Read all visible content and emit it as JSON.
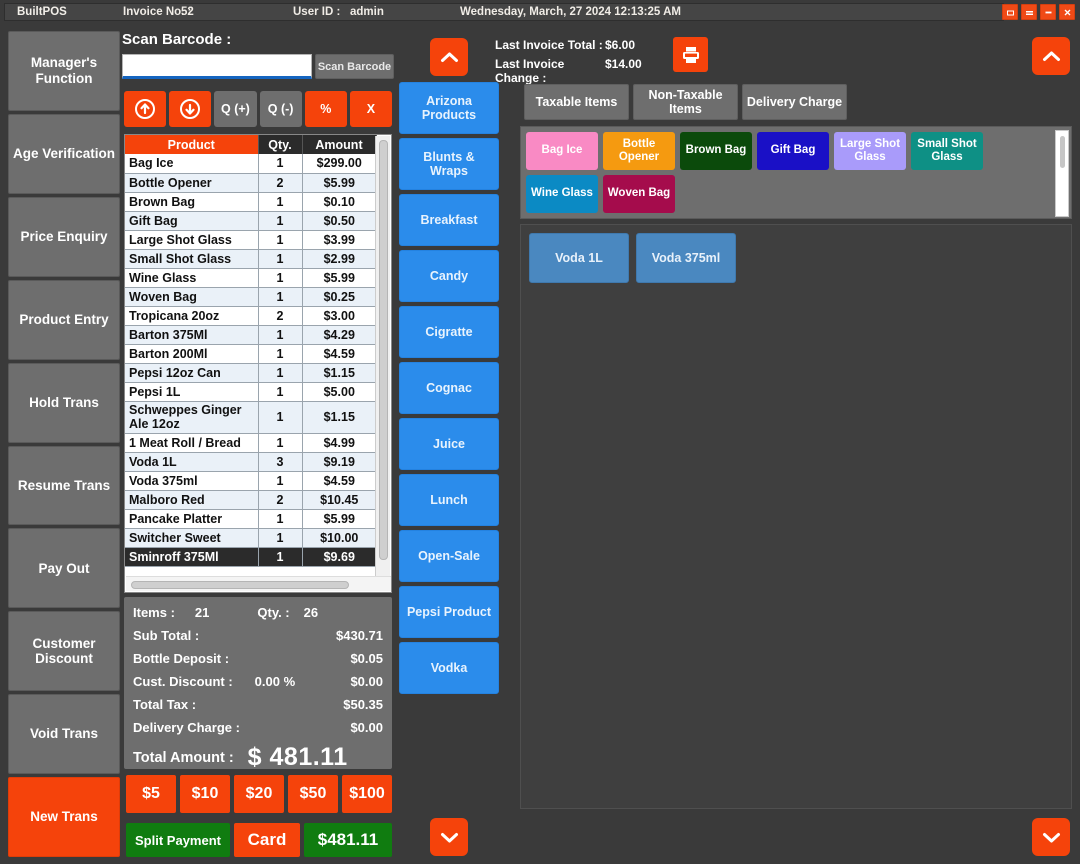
{
  "titlebar": {
    "brand": "BuiltPOS",
    "invoice_label": "Invoice No.  :",
    "invoice_value": "52",
    "user_label": "User ID :",
    "user_value": "admin",
    "datetime": "Wednesday, March, 27 2024 12:13:25 AM",
    "window_buttons": [
      {
        "name": "restore-button",
        "glyph": "❐"
      },
      {
        "name": "minimize-button",
        "glyph": "▂"
      },
      {
        "name": "maximize-button",
        "glyph": "▬"
      },
      {
        "name": "close-button",
        "glyph": "✕"
      }
    ]
  },
  "sidebar": {
    "items": [
      {
        "label": "Manager's Function",
        "accent": false
      },
      {
        "label": "Age Verification",
        "accent": false
      },
      {
        "label": "Price Enquiry",
        "accent": false
      },
      {
        "label": "Product Entry",
        "accent": false
      },
      {
        "label": "Hold Trans",
        "accent": false
      },
      {
        "label": "Resume Trans",
        "accent": false
      },
      {
        "label": "Pay Out",
        "accent": false
      },
      {
        "label": "Customer Discount",
        "accent": false
      },
      {
        "label": "Void Trans",
        "accent": false
      },
      {
        "label": "New Trans",
        "accent": true
      }
    ]
  },
  "scan": {
    "title": "Scan Barcode :",
    "input_value": "",
    "input_placeholder": "",
    "button_label": "Scan Barcode"
  },
  "tools": [
    {
      "name": "qty-up-button",
      "label": "",
      "style": "orange",
      "icon": "arrow-up-circle-icon"
    },
    {
      "name": "qty-down-button",
      "label": "",
      "style": "orange",
      "icon": "arrow-down-circle-icon"
    },
    {
      "name": "quantity-plus-button",
      "label": "Q (+)",
      "style": "grey",
      "icon": ""
    },
    {
      "name": "quantity-minus-button",
      "label": "Q (-)",
      "style": "grey",
      "icon": ""
    },
    {
      "name": "discount-percent-button",
      "label": "%",
      "style": "orange",
      "icon": ""
    },
    {
      "name": "delete-line-button",
      "label": "X",
      "style": "orange",
      "icon": ""
    }
  ],
  "cart": {
    "columns": [
      "Product",
      "Qty.",
      "Amount"
    ],
    "rows": [
      {
        "product": "Bag Ice",
        "qty": "1",
        "amount": "$299.00"
      },
      {
        "product": "Bottle Opener",
        "qty": "2",
        "amount": "$5.99"
      },
      {
        "product": "Brown Bag",
        "qty": "1",
        "amount": "$0.10"
      },
      {
        "product": "Gift Bag",
        "qty": "1",
        "amount": "$0.50"
      },
      {
        "product": "Large Shot Glass",
        "qty": "1",
        "amount": "$3.99"
      },
      {
        "product": "Small Shot Glass",
        "qty": "1",
        "amount": "$2.99"
      },
      {
        "product": "Wine Glass",
        "qty": "1",
        "amount": "$5.99"
      },
      {
        "product": "Woven Bag",
        "qty": "1",
        "amount": "$0.25"
      },
      {
        "product": "Tropicana 20oz",
        "qty": "2",
        "amount": "$3.00"
      },
      {
        "product": "Barton 375Ml",
        "qty": "1",
        "amount": "$4.29"
      },
      {
        "product": "Barton 200Ml",
        "qty": "1",
        "amount": "$4.59"
      },
      {
        "product": "Pepsi 12oz Can",
        "qty": "1",
        "amount": "$1.15"
      },
      {
        "product": "Pepsi 1L",
        "qty": "1",
        "amount": "$5.00"
      },
      {
        "product": "Schweppes Ginger Ale 12oz",
        "qty": "1",
        "amount": "$1.15",
        "tall": true
      },
      {
        "product": "1 Meat Roll / Bread",
        "qty": "1",
        "amount": "$4.99"
      },
      {
        "product": "Voda 1L",
        "qty": "3",
        "amount": "$9.19"
      },
      {
        "product": "Voda 375ml",
        "qty": "1",
        "amount": "$4.59"
      },
      {
        "product": "Malboro Red",
        "qty": "2",
        "amount": "$10.45"
      },
      {
        "product": "Pancake Platter",
        "qty": "1",
        "amount": "$5.99"
      },
      {
        "product": "Switcher Sweet",
        "qty": "1",
        "amount": "$10.00"
      },
      {
        "product": "Sminroff 375Ml",
        "qty": "1",
        "amount": "$9.69",
        "selected": true
      }
    ]
  },
  "totals": {
    "items_label": "Items :",
    "items_value": "21",
    "qty_label": "Qty. :",
    "qty_value": "26",
    "subtotal_label": "Sub Total :",
    "subtotal_value": "$430.71",
    "bottle_deposit_label": "Bottle Deposit :",
    "bottle_deposit_value": "$0.05",
    "discount_label": "Cust. Discount :",
    "discount_percent": "0.00 %",
    "discount_value": "$0.00",
    "tax_label": "Total Tax :",
    "tax_value": "$50.35",
    "delivery_label": "Delivery Charge :",
    "delivery_value": "$0.00",
    "total_label": "Total Amount :",
    "total_value": "$  481.11"
  },
  "cash_buttons": [
    "$5",
    "$10",
    "$20",
    "$50",
    "$100"
  ],
  "payment": {
    "split_label": "Split Payment",
    "card_label": "Card",
    "cash_label": "$481.11"
  },
  "categories": {
    "scroll_up_icon": "chevron-up-icon",
    "scroll_down_icon": "chevron-down-icon",
    "items": [
      "Arizona Products",
      "Blunts & Wraps",
      "Breakfast",
      "Candy",
      "Cigratte",
      "Cognac",
      "Juice",
      "Lunch",
      "Open-Sale",
      "Pepsi Product",
      "Vodka"
    ]
  },
  "invoice_info": {
    "last_total_label": "Last Invoice Total :",
    "last_total_value": "$6.00",
    "last_change_label": "Last Invoice Change :",
    "last_change_value": "$14.00",
    "print_icon": "printer-icon",
    "scroll_up_icon": "chevron-up-icon"
  },
  "tax_tabs": [
    {
      "label": "Taxable Items"
    },
    {
      "label": "Non-Taxable Items"
    },
    {
      "label": "Delivery Charge"
    }
  ],
  "quick_tiles": [
    {
      "label": "Bag Ice",
      "color": "#f98ac4"
    },
    {
      "label": "Bottle Opener",
      "color": "#f59a10"
    },
    {
      "label": "Brown Bag",
      "color": "#0b4a0b"
    },
    {
      "label": "Gift Bag",
      "color": "#1a10c6"
    },
    {
      "label": "Large Shot Glass",
      "color": "#a99bfa"
    },
    {
      "label": "Small Shot Glass",
      "color": "#0e9085"
    },
    {
      "label": "Wine Glass",
      "color": "#0b8ac4"
    },
    {
      "label": "Woven Bag",
      "color": "#a50c4c"
    }
  ],
  "main_tiles": [
    {
      "label": "Voda 1L"
    },
    {
      "label": "Voda 375ml"
    }
  ],
  "bottom": {
    "scroll_down_icon": "chevron-down-icon"
  },
  "colors": {
    "accent_orange": "#f5430b",
    "category_blue": "#2b8ceb",
    "tile_blue": "#4a88c0",
    "pay_green": "#107c10",
    "panel_grey": "#6e6e6e",
    "app_background": "#3a3a3a"
  }
}
